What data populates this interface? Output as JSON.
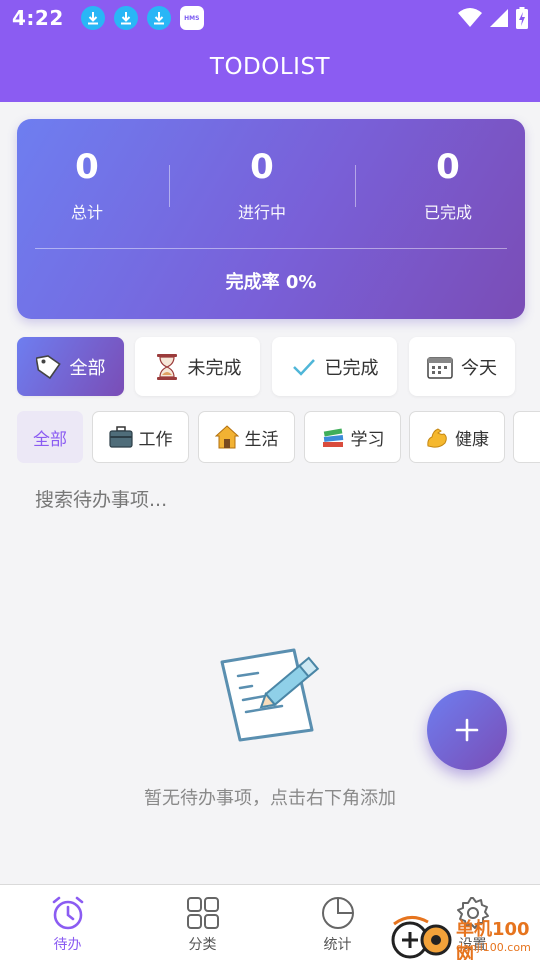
{
  "status_bar": {
    "time": "4:22",
    "notification_icons": [
      "download-icon",
      "download-icon",
      "download-icon",
      "hms-icon"
    ],
    "hms_label": "HMS",
    "right_icons": [
      "wifi-icon",
      "signal-icon",
      "battery-charging-icon"
    ]
  },
  "app_bar": {
    "title": "TODOLIST"
  },
  "stats": {
    "total": {
      "value": "0",
      "label": "总计"
    },
    "in_progress": {
      "value": "0",
      "label": "进行中"
    },
    "completed": {
      "value": "0",
      "label": "已完成"
    },
    "completion_rate": "完成率 0%"
  },
  "status_filters": [
    {
      "label": "全部",
      "icon": "tag-icon",
      "active": true
    },
    {
      "label": "未完成",
      "icon": "hourglass-icon",
      "active": false
    },
    {
      "label": "已完成",
      "icon": "check-icon",
      "active": false
    },
    {
      "label": "今天",
      "icon": "calendar-icon",
      "active": false
    }
  ],
  "categories": [
    {
      "label": "全部",
      "icon": "",
      "active": true
    },
    {
      "label": "工作",
      "icon": "briefcase-icon",
      "active": false
    },
    {
      "label": "生活",
      "icon": "house-icon",
      "active": false
    },
    {
      "label": "学习",
      "icon": "books-icon",
      "active": false
    },
    {
      "label": "健康",
      "icon": "muscle-icon",
      "active": false
    }
  ],
  "search": {
    "placeholder": "搜索待办事项..."
  },
  "empty_state": {
    "text": "暂无待办事项，点击右下角添加",
    "icon": "note-pencil-icon"
  },
  "fab": {
    "label": "+"
  },
  "bottom_nav": [
    {
      "label": "待办",
      "icon": "alarm-clock-icon",
      "active": true
    },
    {
      "label": "分类",
      "icon": "grid-icon",
      "active": false
    },
    {
      "label": "统计",
      "icon": "pie-chart-icon",
      "active": false
    },
    {
      "label": "设置",
      "icon": "gear-icon",
      "active": false
    }
  ],
  "watermark": {
    "line1": "单机100网",
    "line2": "danji100.com"
  },
  "colors": {
    "primary": "#8b5cf2",
    "gradient_start": "#6e7ef0",
    "gradient_end": "#7a4db6",
    "background": "#f4f4f6"
  }
}
